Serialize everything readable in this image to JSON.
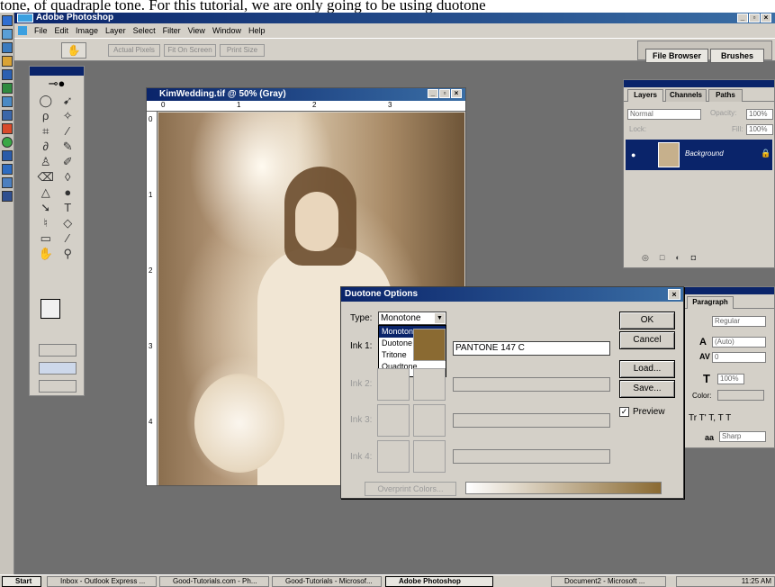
{
  "caption": "tone, of quadraple tone.  For this tutorial, we are only going to be using duotone",
  "app": {
    "title": "Adobe Photoshop"
  },
  "menu": [
    "File",
    "Edit",
    "Image",
    "Layer",
    "Select",
    "Filter",
    "View",
    "Window",
    "Help"
  ],
  "options_bar": {
    "buttons": [
      "Actual Pixels",
      "Fit On Screen",
      "Print Size"
    ],
    "palette_tabs": [
      "File Browser",
      "Brushes"
    ]
  },
  "document": {
    "title": "KimWedding.tif @ 50% (Gray)",
    "ruler_h": [
      "0",
      "1",
      "2",
      "3"
    ],
    "ruler_v": [
      "0",
      "1",
      "2",
      "3",
      "4"
    ]
  },
  "layers_panel": {
    "tabs": [
      "Layers",
      "Channels",
      "Paths"
    ],
    "blend_mode": "Normal",
    "opacity_label": "Opacity:",
    "opacity": "100%",
    "lock_label": "Lock:",
    "fill_label": "Fill:",
    "fill": "100%",
    "layer_name": "Background"
  },
  "char_panel": {
    "tab": "Paragraph",
    "style": "Regular",
    "leading": "(Auto)",
    "tracking": "0",
    "scale": "100%",
    "color_label": "Color:",
    "aa_label": "aa",
    "aa_value": "Sharp",
    "glyphs": "Tr T' T,  T T"
  },
  "dialog": {
    "title": "Duotone Options",
    "type_label": "Type:",
    "type_value": "Monotone",
    "type_options": [
      "Monotone",
      "Duotone",
      "Tritone",
      "Quadtone"
    ],
    "ink1_label": "Ink 1:",
    "ink1_name": "PANTONE 147 C",
    "ink2_label": "Ink 2:",
    "ink3_label": "Ink 3:",
    "ink4_label": "Ink 4:",
    "overprint_label": "Overprint Colors...",
    "ok": "OK",
    "cancel": "Cancel",
    "load": "Load...",
    "save": "Save...",
    "preview_label": "Preview",
    "preview_checked": true
  },
  "taskbar": {
    "start": "Start",
    "items": [
      "Inbox - Outlook Express ...",
      "Good-Tutorials.com - Ph...",
      "Good-Tutorials - Microsof...",
      "Adobe Photoshop",
      "Document2 - Microsoft ..."
    ],
    "clock": "11:25 AM"
  },
  "colors": {
    "title_bar": "#0a246a",
    "chrome": "#d4d0c8",
    "workspace": "#6f6f6f",
    "pantone_147c": "#8a6a32"
  }
}
